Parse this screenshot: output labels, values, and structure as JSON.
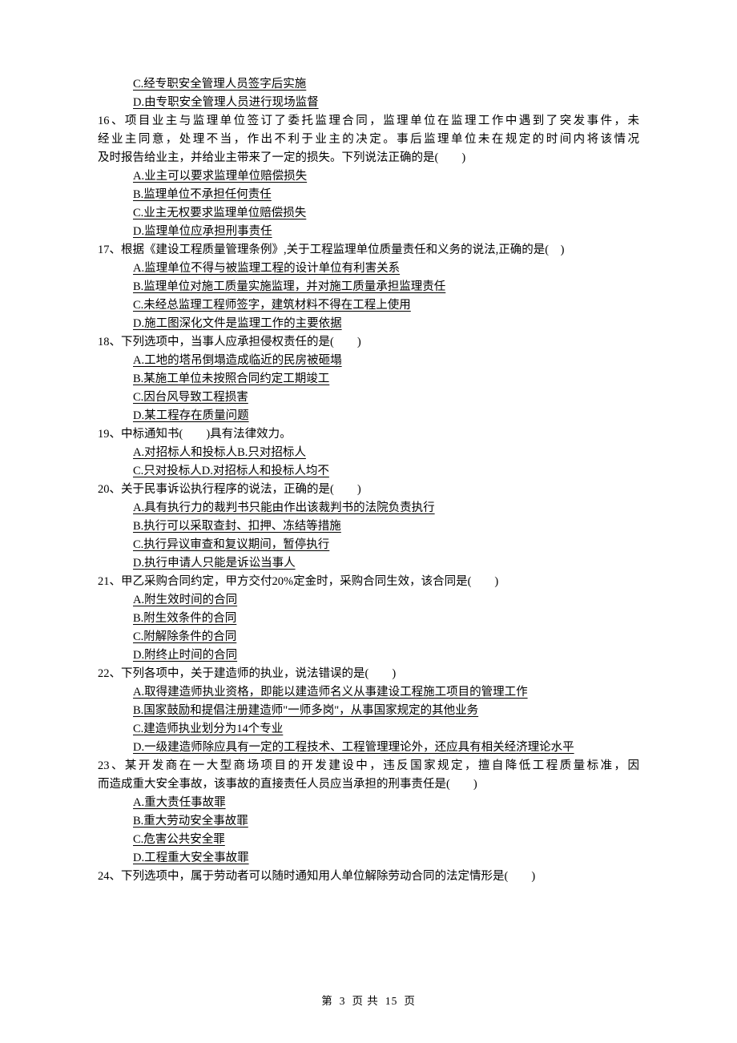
{
  "pre_options": {
    "c": "C.经专职安全管理人员签字后实施",
    "d": "D.由专职安全管理人员进行现场监督"
  },
  "q16": {
    "l1": "16、项目业主与监理单位签订了委托监理合同，监理单位在监理工作中遇到了突发事件，未",
    "l2": "经业主同意，处理不当，作出不利于业主的决定。事后监理单位未在规定的时间内将该情况",
    "l3": "及时报告给业主，并给业主带来了一定的损失。下列说法正确的是(　　)",
    "a": "A.业主可以要求监理单位赔偿损失",
    "b": "B.监理单位不承担任何责任",
    "c": "C.业主无权要求监理单位赔偿损失",
    "d": "D.监理单位应承担刑事责任"
  },
  "q17": {
    "stem": "17、根据《建设工程质量管理条例》,关于工程监理单位质量责任和义务的说法,正确的是(　)",
    "a": "A.监理单位不得与被监理工程的设计单位有利害关系",
    "b": "B.监理单位对施工质量实施监理，并对施工质量承担监理责任",
    "c": "C.未经总监理工程师签字，建筑材料不得在工程上使用",
    "d": "D.施工图深化文件是监理工作的主要依据"
  },
  "q18": {
    "stem": "18、下列选项中，当事人应承担侵权责任的是(　　)",
    "a": "A.工地的塔吊倒塌造成临近的民房被砸塌",
    "b": "B.某施工单位未按照合同约定工期竣工",
    "c": "C.因台风导致工程损害",
    "d": "D.某工程存在质量问题"
  },
  "q19": {
    "stem": "19、中标通知书(　　)具有法律效力。",
    "ab": "A.对招标人和投标人B.只对招标人",
    "cd": "C.只对投标人D.对招标人和投标人均不"
  },
  "q20": {
    "stem": "20、关于民事诉讼执行程序的说法，正确的是(　　)",
    "a": "A.具有执行力的裁判书只能由作出该裁判书的法院负责执行",
    "b": "B.执行可以采取查封、扣押、冻结等措施",
    "c": "C.执行异议审查和复议期间，暂停执行",
    "d": "D.执行申请人只能是诉讼当事人"
  },
  "q21": {
    "stem": "21、甲乙采购合同约定，甲方交付20%定金时，采购合同生效，该合同是(　　)",
    "a": "A.附生效时间的合同",
    "b": "B.附生效条件的合同",
    "c": "C.附解除条件的合同",
    "d": "D.附终止时间的合同"
  },
  "q22": {
    "stem": "22、下列各项中，关于建造师的执业，说法错误的是(　　)",
    "a": "A.取得建造师执业资格，即能以建造师名义从事建设工程施工项目的管理工作",
    "b": "B.国家鼓励和提倡注册建造师\"一师多岗\"，从事国家规定的其他业务",
    "c": "C.建造师执业划分为14个专业",
    "d": "D.一级建造师除应具有一定的工程技术、工程管理理论外，还应具有相关经济理论水平"
  },
  "q23": {
    "l1": "23、某开发商在一大型商场项目的开发建设中，违反国家规定，擅自降低工程质量标准，因",
    "l2": "而造成重大安全事故，该事故的直接责任人员应当承担的刑事责任是(　　)",
    "a": "A.重大责任事故罪",
    "b": "B.重大劳动安全事故罪",
    "c": "C.危害公共安全罪",
    "d": "D.工程重大安全事故罪"
  },
  "q24": {
    "stem": "24、下列选项中，属于劳动者可以随时通知用人单位解除劳动合同的法定情形是(　　)"
  },
  "footer": {
    "cur": "3",
    "total": "15",
    "prefix": "第",
    "mid": "页 共",
    "suffix": "页"
  }
}
